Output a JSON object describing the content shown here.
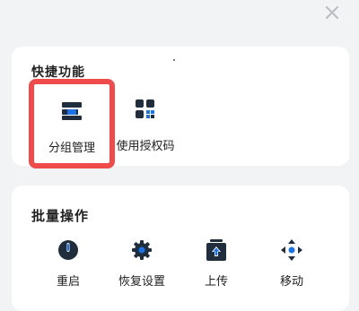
{
  "quick_actions": {
    "title": "快捷功能",
    "items": [
      {
        "label": "分组管理",
        "icon": "group-management-icon"
      },
      {
        "label": "使用授权码",
        "icon": "auth-code-icon"
      }
    ]
  },
  "batch_operations": {
    "title": "批量操作",
    "items": [
      {
        "label": "重启",
        "icon": "power-icon"
      },
      {
        "label": "恢复设置",
        "icon": "gear-icon"
      },
      {
        "label": "上传",
        "icon": "upload-icon"
      },
      {
        "label": "移动",
        "icon": "move-icon"
      }
    ]
  },
  "colors": {
    "accent_blue": "#1a73e8",
    "dark_icon": "#1f2d3d",
    "highlight_red": "#ef4b4b",
    "page_bg": "#f2f3f5",
    "card_bg": "#ffffff"
  }
}
